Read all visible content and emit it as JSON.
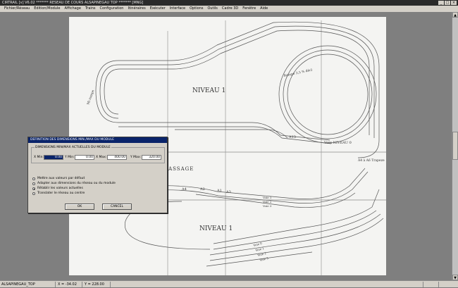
{
  "window": {
    "title": "CIRTRAIL [v] V6.02     ******* RESEAU DE COURS ALSAPINEGAU TOP ******* [MNG]",
    "controls": [
      "_",
      "□",
      "×"
    ]
  },
  "menu": [
    "Fichier/Réseau",
    "Edition/Module",
    "Affichage",
    "Trains",
    "Configuration",
    "Itinéraires",
    "Exécuter",
    "Interface",
    "Options",
    "Outils",
    "Cadre 3D",
    "Fenêtre",
    "Aide"
  ],
  "drawing": {
    "labels": {
      "niveau_top": "NIVEAU 1",
      "niveau_bottom": "NIVEAU 1",
      "passage": "PASSAGE",
      "rampe": "Rampe 3,5 % décl",
      "mi_rampe": "Mi rampe",
      "vers_niveau": "Vers NIVEAU 0",
      "a13": "A13",
      "a4": "A4",
      "a2": "A2",
      "a1": "A1",
      "a3": "A3",
      "vers_top": [
        "Voie 1",
        "Voie 2",
        "Voie 3"
      ],
      "vers_bottom": [
        "Voie 0",
        "Voie 1",
        "Voie 2",
        "Voie 3"
      ],
      "a_right": "A4 à A6 Trapeze"
    }
  },
  "dialog": {
    "title": "DEFINITION DES DIMENSIONS MIN./MAX DU MODULE",
    "group_label": "DIMENSIONS MIN/MAX ACTUELLES DU MODULE",
    "fields": [
      {
        "label": "X Min:",
        "value": "0.00",
        "selected": true
      },
      {
        "label": "Y Min:",
        "value": "0.00",
        "selected": false
      },
      {
        "label": "X Max:",
        "value": "400.00",
        "selected": false
      },
      {
        "label": "Y Max:",
        "value": "320.00",
        "selected": false
      }
    ],
    "options": [
      {
        "label": "Mettre aux valeurs par défaut",
        "checked": false
      },
      {
        "label": "Adapter aux dimensions du réseau ou du module",
        "checked": false
      },
      {
        "label": "Rétablir les valeurs actuelles",
        "checked": true
      },
      {
        "label": "Translater le réseau au centre",
        "checked": false
      }
    ],
    "ok_label": "OK",
    "cancel_label": "CANCEL"
  },
  "status": {
    "module": "ALSAPINEGAU_TOP",
    "x": "X =   -34.02",
    "y": "Y =   228.00"
  }
}
